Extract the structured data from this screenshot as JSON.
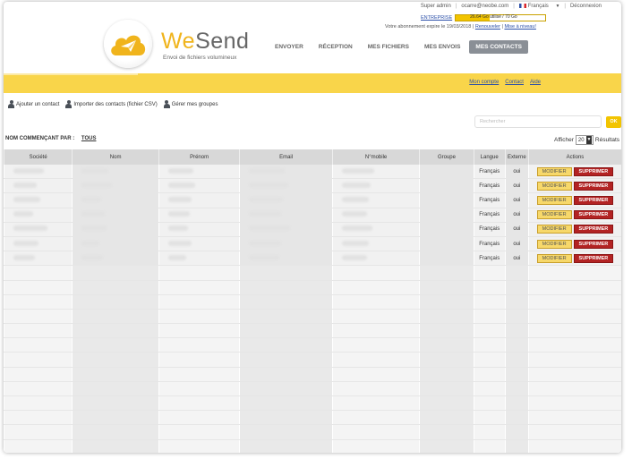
{
  "topbar": {
    "user": "Super admin",
    "email": "ocarre@neobe.com",
    "language": "Français",
    "language_caret": "▼",
    "logout": "Déconnexion"
  },
  "subscription": {
    "plan": "ENTREPRISE",
    "quota_text": "26.64 Go utilisé / 70 Go",
    "quota_fraction": 0.38,
    "expire_text": "Votre abonnement expire le 19/03/2018 |",
    "renew": "Renouveler",
    "upgrade": "Mise à niveau!",
    "sep": "|"
  },
  "brand": {
    "we": "We",
    "send": "Send",
    "tagline": "Envoi de fichiers volumineux"
  },
  "nav": {
    "items": [
      "ENVOYER",
      "RÉCEPTION",
      "MES FICHIERS",
      "MES ENVOIS",
      "MES CONTACTS"
    ],
    "active": "MES CONTACTS"
  },
  "account_links": {
    "my_account": "Mon compte",
    "contact": "Contact",
    "help": "Aide"
  },
  "actions": {
    "add_contact": "Ajouter un contact",
    "import_contacts": "Importer des contacts (fichier CSV)",
    "manage_groups": "Gérer mes groupes"
  },
  "search": {
    "placeholder": "Rechercher",
    "button": "OK"
  },
  "filter": {
    "label": "NOM COMMENÇANT PAR :",
    "value": "TOUS"
  },
  "display": {
    "label": "Afficher",
    "value": "20",
    "suffix": "Résultats"
  },
  "table": {
    "headers": [
      "Société",
      "Nom",
      "Prénom",
      "Email",
      "N°mobile",
      "Groupe",
      "Langue",
      "Externe",
      "Actions"
    ],
    "rows": [
      {
        "langue": "Français",
        "externe": "oui"
      },
      {
        "langue": "Français",
        "externe": "oui"
      },
      {
        "langue": "Français",
        "externe": "oui"
      },
      {
        "langue": "Français",
        "externe": "oui"
      },
      {
        "langue": "Français",
        "externe": "oui"
      },
      {
        "langue": "Français",
        "externe": "oui"
      },
      {
        "langue": "Français",
        "externe": "oui"
      }
    ],
    "modify_label": "MODIFIER",
    "delete_label": "SUPPRIMER",
    "empty_rows": 13
  },
  "colors": {
    "accent": "#f9d54a",
    "brand_yellow": "#f0b41c",
    "delete": "#b32323",
    "nav_active": "#8a8f96"
  }
}
